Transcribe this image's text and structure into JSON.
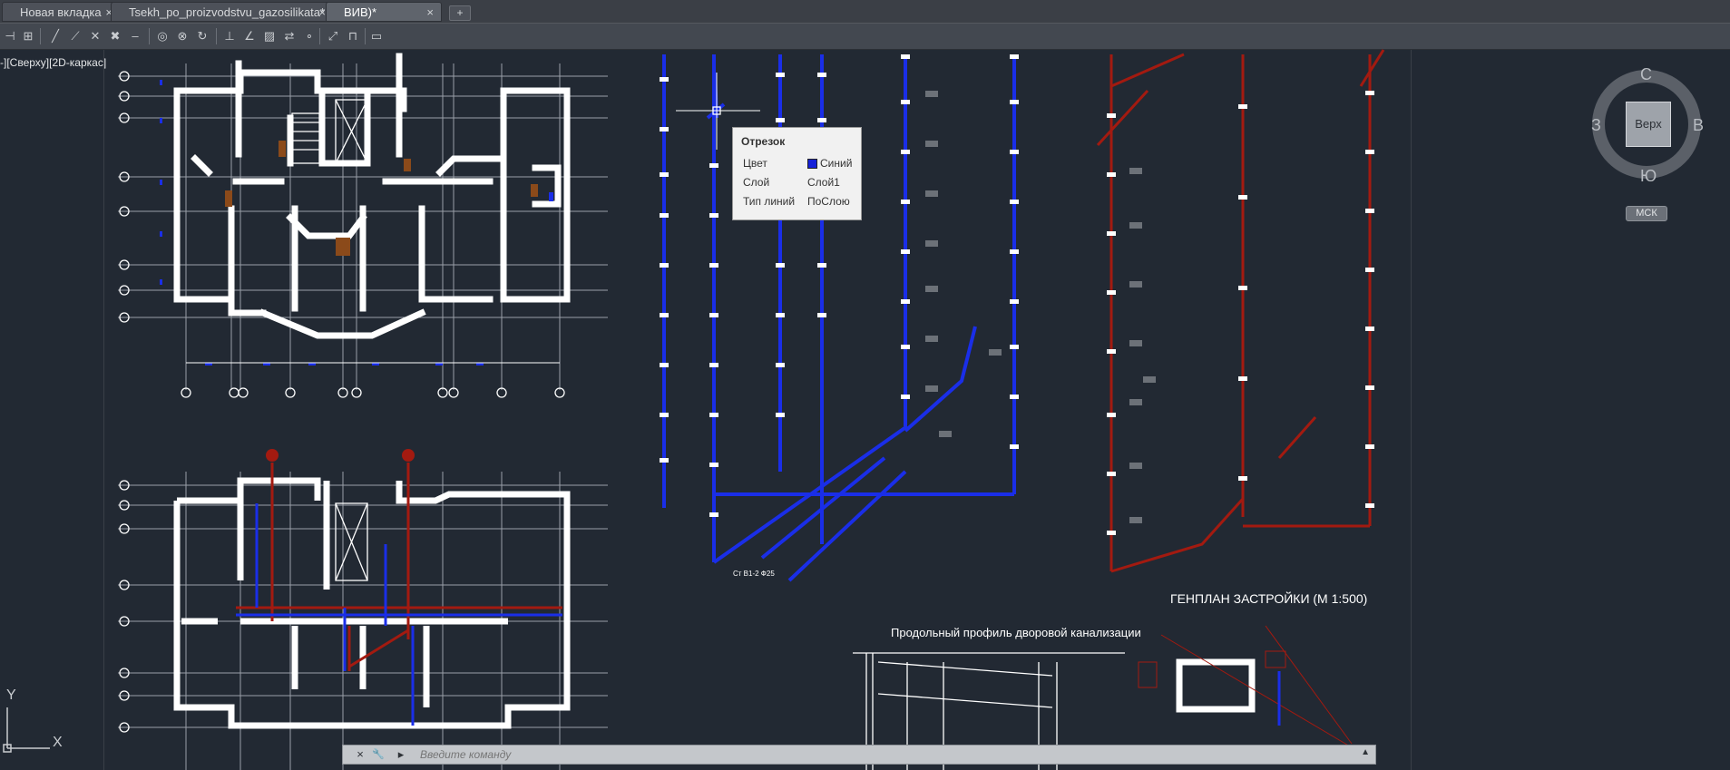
{
  "tabs": [
    {
      "label": "Новая вкладка",
      "close": "×"
    },
    {
      "label": "Tsekh_po_proizvodstvu_gazosilikata*",
      "close": "×"
    },
    {
      "label": "ВИВ)*",
      "close": "×"
    }
  ],
  "new_tab_label": "+",
  "viewport_label": "-][Сверху][2D-каркас]",
  "view_cube": {
    "north": "С",
    "south": "Ю",
    "west": "З",
    "east": "В",
    "top_label": "Верх",
    "ucs_label": "МСК"
  },
  "tooltip": {
    "title": "Отрезок",
    "rows": [
      {
        "key": "Цвет",
        "value": "Синий"
      },
      {
        "key": "Слой",
        "value": "Слой1"
      },
      {
        "key": "Тип линий",
        "value": "ПоСлою"
      }
    ],
    "color_swatch": "#1722d8"
  },
  "drawing_texts": {
    "genplan": "ГЕНПЛАН     ЗАСТРОЙКИ (М 1:500)",
    "profile_title": "Продольный профиль дворовой канализации",
    "riser_label": "Ст В1-2 Ф25"
  },
  "ucs": {
    "x": "X",
    "y": "Y"
  },
  "command": {
    "placeholder": "Введите команду",
    "close_icon": "×",
    "settings_icon": "🔧",
    "prompt_icon": "▸"
  },
  "colors": {
    "background": "#222933",
    "pipe_blue": "#1a2ee8",
    "pipe_red": "#a31a10",
    "walls": "#ffffff",
    "gridline": "#9aa0a8",
    "tab_bar": "#3b3f46"
  },
  "icons": [
    "line-icon",
    "polyline-icon",
    "circle-icon",
    "arc-icon",
    "rectangle-icon",
    "snap-icon",
    "ortho-icon",
    "grid-icon",
    "move-icon",
    "copy-icon"
  ]
}
